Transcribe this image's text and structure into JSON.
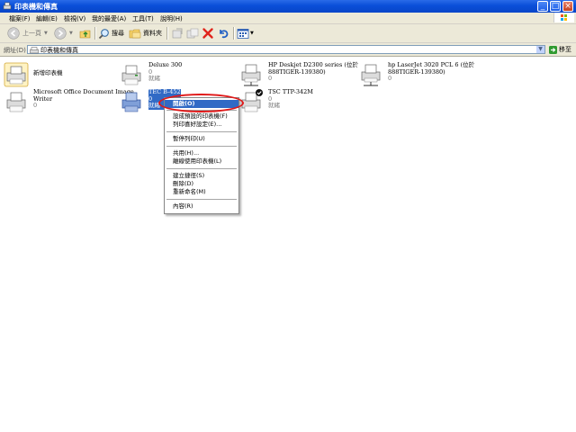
{
  "window": {
    "title": "印表機和傳真"
  },
  "menubar": {
    "items": [
      "檔案(F)",
      "編輯(E)",
      "檢視(V)",
      "我的最愛(A)",
      "工具(T)",
      "說明(H)"
    ]
  },
  "toolbar": {
    "back_label": "上一頁",
    "search_label": "搜尋",
    "folders_label": "資料夾"
  },
  "address": {
    "label": "網址(D)",
    "value": "印表機和傳真",
    "go_label": "移至"
  },
  "printers": [
    {
      "name": "新增印表機",
      "line1": "",
      "line2": ""
    },
    {
      "name": "Deluxe 300",
      "line1": "0",
      "line2": "就緒"
    },
    {
      "name": "HP Deskjet D2300 series (位於",
      "name2": "888TIGER-139380)",
      "line1": "0"
    },
    {
      "name": "hp LaserJet 3020 PCL 6 (位於",
      "name2": "888TIGER-139380)",
      "line1": "0"
    },
    {
      "name": "Microsoft Office Document Image",
      "name2": "Writer",
      "line1": "0"
    },
    {
      "name": "TEC B-452",
      "line1": "0",
      "line2": "就緒"
    },
    {
      "name": "TSC TTP-342M",
      "line1": "0",
      "line2": "就緒"
    }
  ],
  "context_menu": {
    "items": [
      "開啟(O)",
      "設成預設的印表機(F)",
      "列印喜好設定(E)...",
      "暫停列印(U)",
      "共用(H)...",
      "離線使用印表機(L)",
      "建立捷徑(S)",
      "刪除(D)",
      "重新命名(M)",
      "內容(R)"
    ],
    "highlighted": "開啟(O)"
  },
  "colors": {
    "titlebar": "#0a4fd8",
    "selection": "#316ac5",
    "annotation": "#e01818"
  }
}
